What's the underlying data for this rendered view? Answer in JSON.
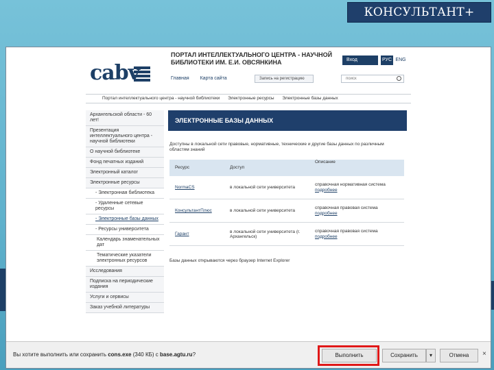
{
  "banner": {
    "title": "КОНСУЛЬТАНТ+"
  },
  "header": {
    "logo_text": "cabv",
    "portal_title": "ПОРТАЛ ИНТЕЛЛЕКТУАЛЬНОГО ЦЕНТРА - НАУЧНОЙ БИБЛИОТЕКИ ИМ. Е.И. ОВСЯНКИНА",
    "login_label": "Вход",
    "lang_rus": "РУС",
    "lang_eng": "ENG",
    "toplinks": [
      "Главная",
      "Карта сайта"
    ],
    "register_label": "Запись на регистрацию",
    "search_placeholder": "поиск"
  },
  "breadcrumbs": [
    "Портал интеллектуального центра - научной библиотеки",
    "Электронные ресурсы",
    "Электронные базы данных"
  ],
  "sidebar": {
    "items": [
      "Архангельской области - 60 лет!",
      "Презентация интеллектуального центра - научной библиотеки",
      "О научной библиотеке",
      "Фонд печатных изданий",
      "Электронный каталог",
      "Электронные ресурсы",
      "- Электронная библиотека",
      "- Удаленные сетевые ресурсы",
      "- Электронные базы данных",
      "- Ресурсы университета",
      "Календарь знаменательных дат",
      "Тематические указатели электронных ресурсов",
      "Исследования",
      "Подписка на периодические издания",
      "Услуги и сервисы",
      "Заказ учебной литературы"
    ]
  },
  "main": {
    "section_title": "ЭЛЕКТРОННЫЕ БАЗЫ ДАННЫХ",
    "intro": "Доступны в локальной сети правовые, нормативные, технические и другие базы данных по различным областям знаний",
    "columns": [
      "Ресурс",
      "Доступ",
      "Описание"
    ],
    "rows": [
      {
        "name": "NormaCS",
        "access": "в локальной сети университета",
        "desc": "справочная нормативная система",
        "link": "подробнее"
      },
      {
        "name": "КонсультантПлюс",
        "access": "в локальной сети университета",
        "desc": "справочная правовая система",
        "link": "подробнее"
      },
      {
        "name": "Гарант",
        "access": "в локальной сети университета (г. Архангельск)",
        "desc": "справочная правовая система",
        "link": "подробнее"
      }
    ],
    "note": "Базы данных открываются через браузер Internet Explorer"
  },
  "download_bar": {
    "message_prefix": "Вы хотите выполнить или сохранить",
    "file": "cons.exe",
    "size": "(340 КБ)",
    "from": "с",
    "host": "base.agtu.ru",
    "suffix": "?",
    "run_label": "Выполнить",
    "save_label": "Сохранить",
    "cancel_label": "Отмена",
    "close_glyph": "×"
  },
  "colors": {
    "brand": "#1f3f6b",
    "highlight": "#e01818",
    "background": "#6bbbd3"
  }
}
